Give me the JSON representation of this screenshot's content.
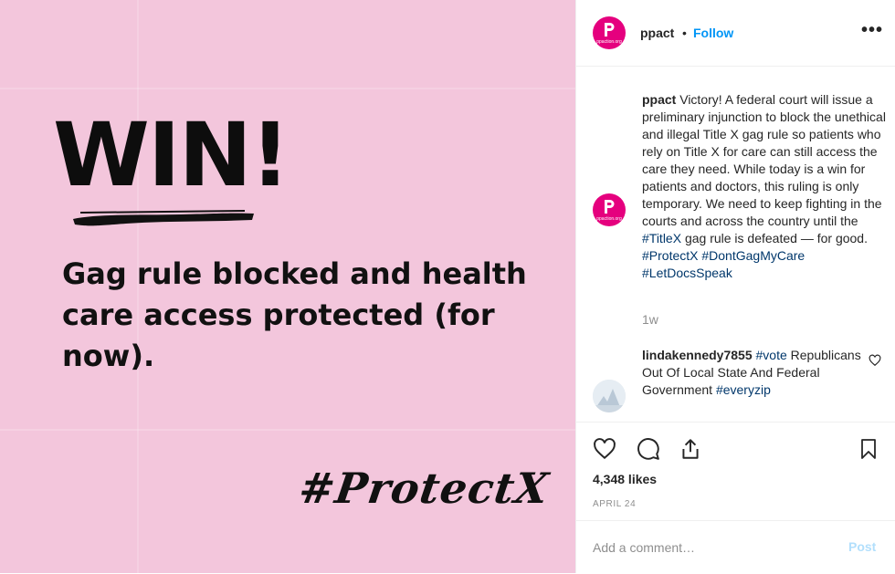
{
  "post_image": {
    "headline": "WIN!",
    "subhead": "Gag rule blocked and health care access protected (for now).",
    "hashtag": "#ProtectX",
    "background_color": "#f3c6dc"
  },
  "header": {
    "username": "ppact",
    "separator": "•",
    "follow_label": "Follow",
    "more_icon": "more-options-icon",
    "avatar_caption": "ppaction.org"
  },
  "caption": {
    "username": "ppact",
    "text_1": " Victory! A federal court will issue a preliminary injunction to block the unethical and illegal Title X gag rule so patients who rely on Title X for care can still access the care they need. While today is a win for patients and doctors, this ruling is only temporary. We need to keep fighting in the courts and across the country until the ",
    "tag_1": "#TitleX",
    "text_2": " gag rule is defeated — for good. ",
    "tag_2": "#ProtectX",
    "text_3": " ",
    "tag_3": "#DontGagMyCare",
    "text_4": " ",
    "tag_4": "#LetDocsSpeak",
    "time": "1w"
  },
  "comment": {
    "username": "lindakennedy7855",
    "tag_1": "#vote",
    "text": " Republicans Out Of Local State And Federal Government ",
    "tag_2": "#everyzip"
  },
  "actions": {
    "likes": "4,348 likes",
    "date": "APRIL 24"
  },
  "add_comment": {
    "placeholder": "Add a comment…",
    "post_label": "Post"
  },
  "colors": {
    "accent": "#0095f6",
    "brand": "#e5007e",
    "hashtag": "#00376b"
  }
}
